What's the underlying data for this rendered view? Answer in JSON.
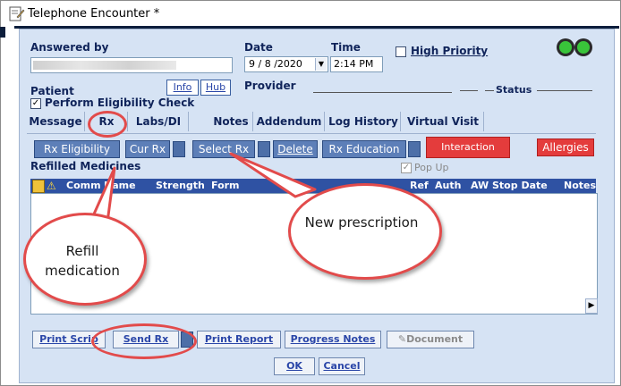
{
  "window": {
    "title": "Telephone Encounter *"
  },
  "header": {
    "answered_by_label": "Answered by",
    "date_label": "Date",
    "date_value": "9 / 8 /2020",
    "time_label": "Time",
    "time_value": "2:14 PM",
    "high_priority_label": "High Priority",
    "patient_label": "Patient",
    "info_button": "Info",
    "hub_button": "Hub",
    "provider_label": "Provider",
    "status_label": "Status",
    "eligibility_label": "Perform Eligibility Check"
  },
  "tabs": [
    "Message",
    "Rx",
    "Labs/DI",
    "Notes",
    "Addendum",
    "Log History",
    "Virtual Visit"
  ],
  "toolbar": {
    "rx_eligibility": "Rx Eligibility",
    "cur_rx": "Cur Rx",
    "select_rx": "Select Rx",
    "delete": "Delete",
    "rx_education": "Rx Education",
    "interaction": "Interaction",
    "allergies": "Allergies"
  },
  "section": {
    "title": "Refilled Medicines",
    "popup_label": "Pop Up"
  },
  "grid": {
    "columns": [
      "Comm",
      "Name",
      "Strength",
      "Form",
      "Ref",
      "Auth",
      "AW",
      "Stop Date",
      "Notes"
    ]
  },
  "bottom": {
    "print_script": "Print Scrip",
    "send_rx": "Send Rx",
    "print_report": "Print Report",
    "progress_notes": "Progress Notes",
    "document": "Document",
    "ok": "OK",
    "cancel": "Cancel"
  },
  "annotations": {
    "refill": "Refill medication",
    "new_rx": "New prescription"
  },
  "colors": {
    "accent": "#2f52a3",
    "callout_border": "#e24b4b",
    "interaction_red": "#e43c3c",
    "status_green": "#39c43a"
  }
}
